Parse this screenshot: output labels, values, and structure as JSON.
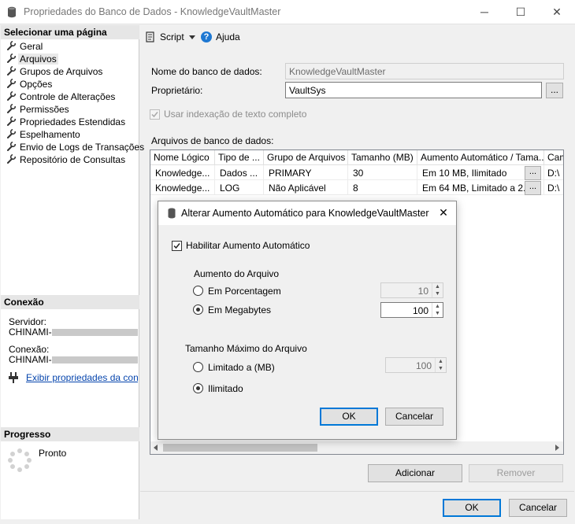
{
  "window": {
    "title": "Propriedades do Banco de Dados - KnowledgeVaultMaster",
    "minimize": "─",
    "maximize": "☐",
    "close": "✕"
  },
  "left": {
    "select_page_header": "Selecionar uma página",
    "items": [
      {
        "label": "Geral"
      },
      {
        "label": "Arquivos"
      },
      {
        "label": "Grupos de Arquivos"
      },
      {
        "label": "Opções"
      },
      {
        "label": "Controle de Alterações"
      },
      {
        "label": "Permissões"
      },
      {
        "label": "Propriedades Estendidas"
      },
      {
        "label": "Espelhamento"
      },
      {
        "label": "Envio de Logs de Transações"
      },
      {
        "label": "Repositório de Consultas"
      }
    ],
    "connection_header": "Conexão",
    "server_label": "Servidor:",
    "server_value": "CHINAMI-",
    "connection_label": "Conexão:",
    "connection_value": "CHINAMI-",
    "view_properties_link": "Exibir propriedades da conexã",
    "progress_header": "Progresso",
    "progress_status": "Pronto"
  },
  "toolbar": {
    "script_label": "Script",
    "help_label": "Ajuda"
  },
  "form": {
    "db_name_label": "Nome do banco de dados:",
    "db_name_value": "KnowledgeVaultMaster",
    "owner_label": "Proprietário:",
    "owner_value": "VaultSys",
    "browse": "...",
    "fulltext_label": "Usar indexação de texto completo",
    "files_label": "Arquivos de banco de dados:"
  },
  "grid": {
    "columns": [
      "Nome Lógico",
      "Tipo de ...",
      "Grupo de Arquivos",
      "Tamanho (MB)",
      "Aumento Automático / Tama...",
      "Cam"
    ],
    "rows": [
      {
        "name": "Knowledge...",
        "type": "Dados ...",
        "group": "PRIMARY",
        "size": "30",
        "autogrow": "Em 10 MB, Ilimitado",
        "path": "D:\\"
      },
      {
        "name": "Knowledge...",
        "type": "LOG",
        "group": "Não Aplicável",
        "size": "8",
        "autogrow": "Em 64 MB, Limitado a 2...",
        "path": "D:\\"
      }
    ],
    "ellipsis": "..."
  },
  "dialog": {
    "title": "Alterar Aumento Automático para KnowledgeVaultMaster",
    "close": "✕",
    "enable_label": "Habilitar Aumento Automático",
    "file_growth_label": "Aumento do Arquivo",
    "percent_label": "Em Porcentagem",
    "percent_value": "10",
    "mb_label": "Em Megabytes",
    "mb_value": "100",
    "max_size_label": "Tamanho Máximo do Arquivo",
    "limited_label": "Limitado a (MB)",
    "limited_value": "100",
    "unlimited_label": "Ilimitado",
    "ok": "OK",
    "cancel": "Cancelar"
  },
  "bottom": {
    "add": "Adicionar",
    "remove": "Remover",
    "ok": "OK",
    "cancel": "Cancelar"
  }
}
